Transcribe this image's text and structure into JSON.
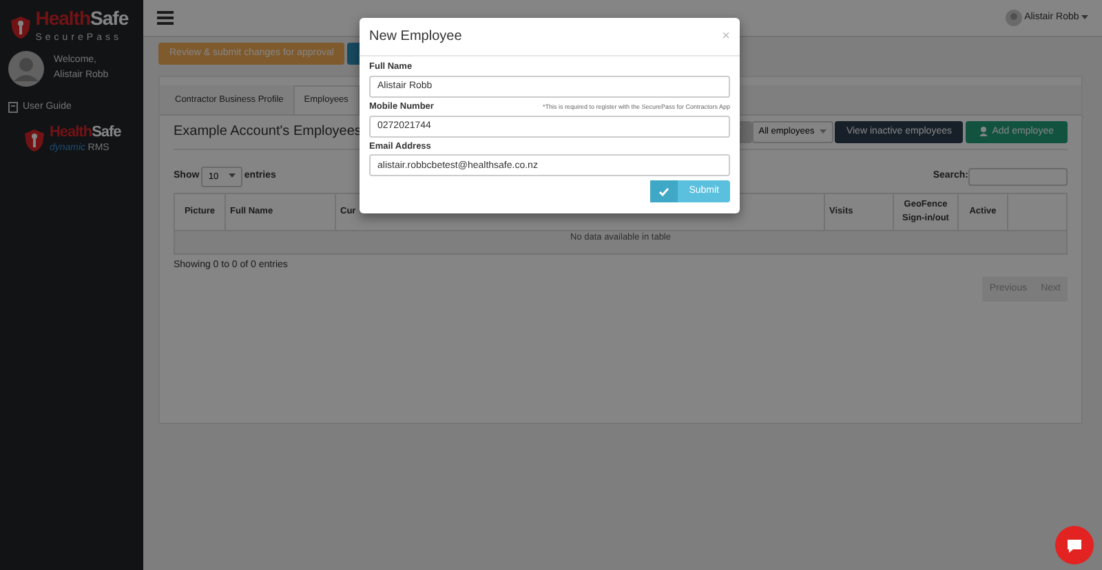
{
  "sidebar": {
    "logo": {
      "word_1": "Health",
      "word_2": "Safe",
      "tagline": "SecurePass"
    },
    "welcome": "Welcome,",
    "user_name": "Alistair Robb",
    "items": [
      {
        "label": "User Guide"
      }
    ],
    "footer_logo": {
      "word_1": "Health",
      "word_2": "Safe",
      "script": "dynamic",
      "tagline": "RMS"
    }
  },
  "topbar": {
    "user": "Alistair Robb"
  },
  "review_button": "Review & submit changes for approval",
  "tabs": [
    {
      "label": "Contractor Business Profile",
      "selected": false
    },
    {
      "label": "Employees",
      "selected": true
    }
  ],
  "heading": "Example Account's Employees",
  "filter": {
    "dropdown": "All employees"
  },
  "buttons": [
    {
      "label": "View inactive employees",
      "kind": "dark"
    },
    {
      "label": "Add employee",
      "kind": "add"
    }
  ],
  "length": {
    "show": "Show",
    "value": "10",
    "entries": "entries"
  },
  "search": {
    "label": "Search:"
  },
  "table": {
    "columns": [
      "Picture",
      "Full Name",
      "Cur",
      "Visits",
      "GeoFence Sign-in/out",
      "Active"
    ],
    "empty": "No data available in table"
  },
  "info": "Showing 0 to 0 of 0 entries",
  "pagination": [
    {
      "label": "Previous",
      "disabled": true
    },
    {
      "label": "Next",
      "disabled": true
    }
  ],
  "modal": {
    "title": "New Employee",
    "close": "×",
    "fields": [
      {
        "label": "Full Name",
        "value": "Alistair Robb"
      },
      {
        "label": "Mobile Number",
        "value": "0272021744",
        "hint": "*This is required to register with the SecurePass for Contractors App"
      },
      {
        "label": "Email Address",
        "value": "alistair.robbcbetest@healthsafe.co.nz"
      }
    ],
    "submit": "Submit"
  }
}
